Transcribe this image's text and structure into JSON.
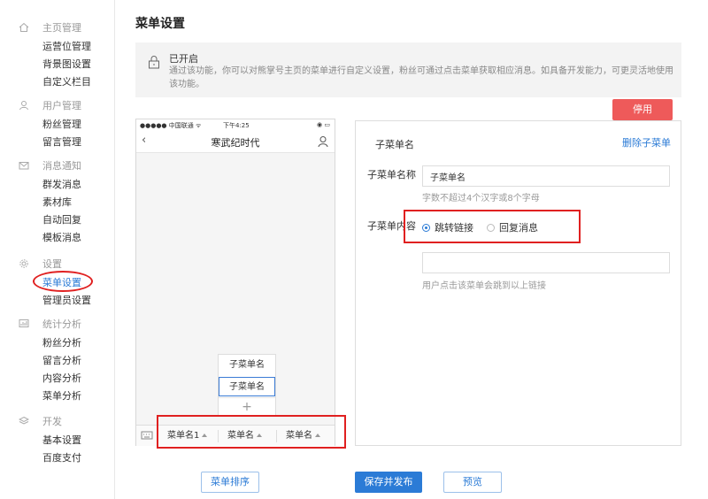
{
  "sidebar": {
    "groups": [
      {
        "title": "主页管理",
        "icon": "home-icon",
        "items": [
          "运营位管理",
          "背景图设置",
          "自定义栏目"
        ]
      },
      {
        "title": "用户管理",
        "icon": "user-icon",
        "items": [
          "粉丝管理",
          "留言管理"
        ]
      },
      {
        "title": "消息通知",
        "icon": "mail-icon",
        "items": [
          "群发消息",
          "素材库",
          "自动回复",
          "模板消息"
        ]
      },
      {
        "title": "设置",
        "icon": "gear-icon",
        "items": [
          "菜单设置",
          "管理员设置"
        ]
      },
      {
        "title": "统计分析",
        "icon": "chart-icon",
        "items": [
          "粉丝分析",
          "留言分析",
          "内容分析",
          "菜单分析"
        ]
      },
      {
        "title": "开发",
        "icon": "layers-icon",
        "items": [
          "基本设置",
          "百度支付"
        ]
      }
    ],
    "active_item": "菜单设置"
  },
  "page": {
    "title": "菜单设置"
  },
  "notice": {
    "title": "已开启",
    "text": "通过该功能，你可以对熊掌号主页的菜单进行自定义设置，粉丝可通过点击菜单获取相应消息。如具备开发能力，可更灵活地使用该功能。"
  },
  "stop_button": "停用",
  "phone": {
    "carrier": "●●●●● 中国联通 ᯤ",
    "time": "下午4:25",
    "battery": "◉ ▭",
    "account_name": "寒武纪时代",
    "submenu_items": [
      "子菜单名",
      "子菜单名"
    ],
    "submenu_add": "+",
    "main_menus": [
      "菜单名1",
      "菜单名",
      "菜单名"
    ]
  },
  "editor": {
    "title": "子菜单名",
    "delete_link": "删除子菜单",
    "name_label": "子菜单名称",
    "name_value": "子菜单名",
    "name_hint": "字数不超过4个汉字或8个字母",
    "content_label": "子菜单内容",
    "options": [
      "跳转链接",
      "回复消息"
    ],
    "selected_option": "跳转链接",
    "url_value": "",
    "url_hint": "用户点击该菜单会跳到以上链接"
  },
  "footer": {
    "sort_button": "菜单排序",
    "save_button": "保存并发布",
    "preview_button": "预览"
  },
  "colors": {
    "accent": "#2b7bd6",
    "danger": "#ee5a5a",
    "highlight": "#e02020"
  }
}
